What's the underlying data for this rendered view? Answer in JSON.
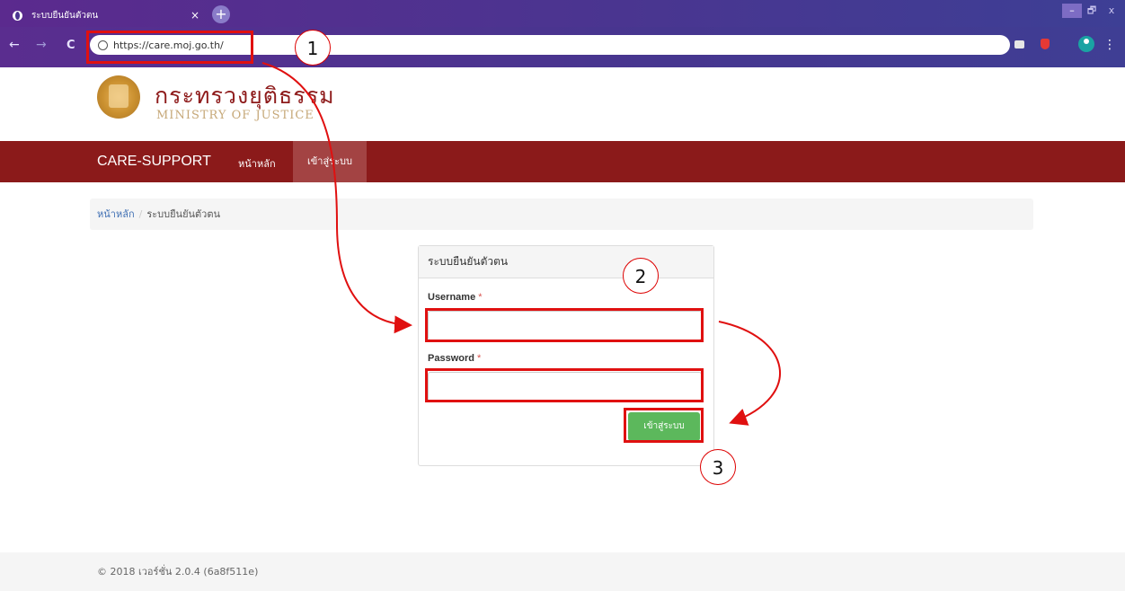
{
  "browser": {
    "tab_title": "ระบบยืนยันตัวตน",
    "close_glyph": "×",
    "newtab_glyph": "+",
    "url": "https://care.moj.go.th/",
    "back_glyph": "←",
    "forward_glyph": "→",
    "reload_glyph": "C",
    "menu_glyph": "⋮",
    "window_controls": [
      "–",
      "🗗",
      "x"
    ]
  },
  "header": {
    "logo_th": "กระทรวงยุติธรรม",
    "logo_en": "MINISTRY OF JUSTICE"
  },
  "navbar": {
    "brand": "CARE-SUPPORT",
    "home": "หน้าหลัก",
    "login": "เข้าสู่ระบบ"
  },
  "breadcrumb": {
    "home": "หน้าหลัก",
    "separator": "/",
    "current": "ระบบยืนยันตัวตน"
  },
  "login_panel": {
    "title": "ระบบยืนยันตัวตน",
    "username_label": "Username",
    "password_label": "Password",
    "required_mark": "*",
    "username_value": "",
    "password_value": "",
    "submit_label": "เข้าสู่ระบบ"
  },
  "footer": {
    "text": "© 2018 เวอร์ชั่น 2.0.4 (6a8f511e)"
  },
  "annotations": {
    "step1": "1",
    "step2": "2",
    "step3": "3"
  },
  "colors": {
    "navbar": "#8b1a1a",
    "highlight": "#e01010",
    "button": "#5cb85c",
    "chrome": "#4a3590"
  }
}
